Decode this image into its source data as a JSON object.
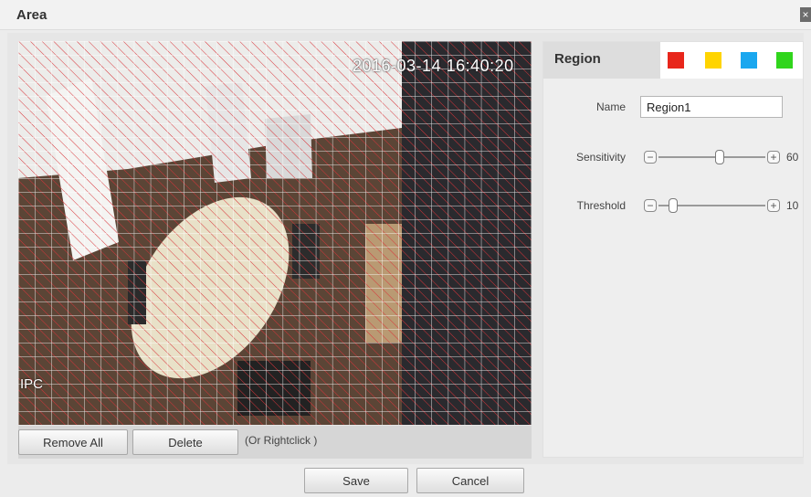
{
  "dialog": {
    "title": "Area",
    "close_label": "×"
  },
  "video": {
    "timestamp": "2016-03-14 16:40:20",
    "channel_label": "IPC"
  },
  "buttons": {
    "remove_all": "Remove All",
    "delete": "Delete",
    "hint": "(Or Rightclick )",
    "save": "Save",
    "cancel": "Cancel"
  },
  "panel": {
    "title": "Region",
    "swatches": [
      {
        "name": "red",
        "color": "#e8261b"
      },
      {
        "name": "yellow",
        "color": "#ffd400"
      },
      {
        "name": "blue",
        "color": "#1aa7ef"
      },
      {
        "name": "green",
        "color": "#30d51c"
      }
    ],
    "name_label": "Name",
    "name_value": "Region1",
    "sensitivity_label": "Sensitivity",
    "sensitivity_value": "60",
    "threshold_label": "Threshold",
    "threshold_value": "10"
  },
  "icons": {
    "minus": "−",
    "plus": "+"
  }
}
